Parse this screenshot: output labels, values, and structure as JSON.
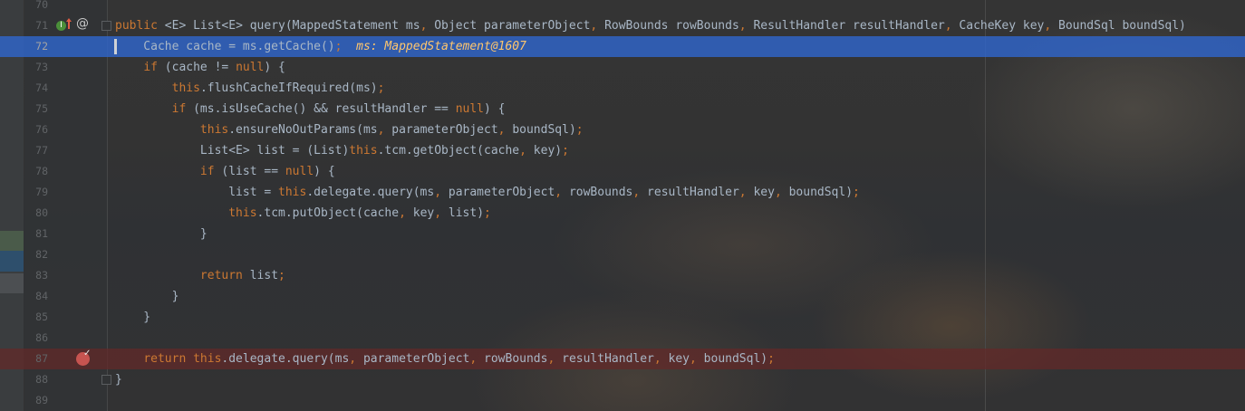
{
  "editor": {
    "lines": [
      {
        "num": "70",
        "tokens": []
      },
      {
        "num": "71",
        "tokens": [
          {
            "t": "public ",
            "c": "kw"
          },
          {
            "t": "<E> List<E> query(MappedStatement ms",
            "c": "ty"
          },
          {
            "t": ", ",
            "c": "punc"
          },
          {
            "t": "Object parameterObject",
            "c": "ty"
          },
          {
            "t": ", ",
            "c": "punc"
          },
          {
            "t": "RowBounds rowBounds",
            "c": "ty"
          },
          {
            "t": ", ",
            "c": "punc"
          },
          {
            "t": "ResultHandler resultHandler",
            "c": "ty"
          },
          {
            "t": ", ",
            "c": "punc"
          },
          {
            "t": "CacheKey key",
            "c": "ty"
          },
          {
            "t": ", ",
            "c": "punc"
          },
          {
            "t": "BoundSql boundSql)",
            "c": "ty"
          }
        ]
      },
      {
        "num": "72",
        "tokens": [
          {
            "t": "    Cache cache = ms.getCache()",
            "c": "ty"
          },
          {
            "t": ";  ",
            "c": "punc"
          },
          {
            "t": "ms: MappedStatement@1607",
            "c": "dbg"
          }
        ]
      },
      {
        "num": "73",
        "tokens": [
          {
            "t": "    ",
            "c": "ty"
          },
          {
            "t": "if ",
            "c": "kw"
          },
          {
            "t": "(cache != ",
            "c": "ty"
          },
          {
            "t": "null",
            "c": "kw"
          },
          {
            "t": ") {",
            "c": "ty"
          }
        ]
      },
      {
        "num": "74",
        "tokens": [
          {
            "t": "        ",
            "c": "ty"
          },
          {
            "t": "this",
            "c": "kw"
          },
          {
            "t": ".flushCacheIfRequired(ms)",
            "c": "ty"
          },
          {
            "t": ";",
            "c": "punc"
          }
        ]
      },
      {
        "num": "75",
        "tokens": [
          {
            "t": "        ",
            "c": "ty"
          },
          {
            "t": "if ",
            "c": "kw"
          },
          {
            "t": "(ms.isUseCache() && resultHandler == ",
            "c": "ty"
          },
          {
            "t": "null",
            "c": "kw"
          },
          {
            "t": ") {",
            "c": "ty"
          }
        ]
      },
      {
        "num": "76",
        "tokens": [
          {
            "t": "            ",
            "c": "ty"
          },
          {
            "t": "this",
            "c": "kw"
          },
          {
            "t": ".ensureNoOutParams(ms",
            "c": "ty"
          },
          {
            "t": ", ",
            "c": "punc"
          },
          {
            "t": "parameterObject",
            "c": "ty"
          },
          {
            "t": ", ",
            "c": "punc"
          },
          {
            "t": "boundSql)",
            "c": "ty"
          },
          {
            "t": ";",
            "c": "punc"
          }
        ]
      },
      {
        "num": "77",
        "tokens": [
          {
            "t": "            List<E> list = (List)",
            "c": "ty"
          },
          {
            "t": "this",
            "c": "kw"
          },
          {
            "t": ".tcm.getObject(cache",
            "c": "ty"
          },
          {
            "t": ", ",
            "c": "punc"
          },
          {
            "t": "key)",
            "c": "ty"
          },
          {
            "t": ";",
            "c": "punc"
          }
        ]
      },
      {
        "num": "78",
        "tokens": [
          {
            "t": "            ",
            "c": "ty"
          },
          {
            "t": "if ",
            "c": "kw"
          },
          {
            "t": "(list == ",
            "c": "ty"
          },
          {
            "t": "null",
            "c": "kw"
          },
          {
            "t": ") {",
            "c": "ty"
          }
        ]
      },
      {
        "num": "79",
        "tokens": [
          {
            "t": "                list = ",
            "c": "ty"
          },
          {
            "t": "this",
            "c": "kw"
          },
          {
            "t": ".delegate.query(ms",
            "c": "ty"
          },
          {
            "t": ", ",
            "c": "punc"
          },
          {
            "t": "parameterObject",
            "c": "ty"
          },
          {
            "t": ", ",
            "c": "punc"
          },
          {
            "t": "rowBounds",
            "c": "ty"
          },
          {
            "t": ", ",
            "c": "punc"
          },
          {
            "t": "resultHandler",
            "c": "ty"
          },
          {
            "t": ", ",
            "c": "punc"
          },
          {
            "t": "key",
            "c": "ty"
          },
          {
            "t": ", ",
            "c": "punc"
          },
          {
            "t": "boundSql)",
            "c": "ty"
          },
          {
            "t": ";",
            "c": "punc"
          }
        ]
      },
      {
        "num": "80",
        "tokens": [
          {
            "t": "                ",
            "c": "ty"
          },
          {
            "t": "this",
            "c": "kw"
          },
          {
            "t": ".tcm.putObject(cache",
            "c": "ty"
          },
          {
            "t": ", ",
            "c": "punc"
          },
          {
            "t": "key",
            "c": "ty"
          },
          {
            "t": ", ",
            "c": "punc"
          },
          {
            "t": "list)",
            "c": "ty"
          },
          {
            "t": ";",
            "c": "punc"
          }
        ]
      },
      {
        "num": "81",
        "tokens": [
          {
            "t": "            }",
            "c": "ty"
          }
        ]
      },
      {
        "num": "82",
        "tokens": []
      },
      {
        "num": "83",
        "tokens": [
          {
            "t": "            ",
            "c": "ty"
          },
          {
            "t": "return ",
            "c": "kw"
          },
          {
            "t": "list",
            "c": "ty"
          },
          {
            "t": ";",
            "c": "punc"
          }
        ]
      },
      {
        "num": "84",
        "tokens": [
          {
            "t": "        }",
            "c": "ty"
          }
        ]
      },
      {
        "num": "85",
        "tokens": [
          {
            "t": "    }",
            "c": "ty"
          }
        ]
      },
      {
        "num": "86",
        "tokens": []
      },
      {
        "num": "87",
        "tokens": [
          {
            "t": "    ",
            "c": "ty"
          },
          {
            "t": "return this",
            "c": "kw"
          },
          {
            "t": ".delegate.query(ms",
            "c": "ty"
          },
          {
            "t": ", ",
            "c": "punc"
          },
          {
            "t": "parameterObject",
            "c": "ty"
          },
          {
            "t": ", ",
            "c": "punc"
          },
          {
            "t": "rowBounds",
            "c": "ty"
          },
          {
            "t": ", ",
            "c": "punc"
          },
          {
            "t": "resultHandler",
            "c": "ty"
          },
          {
            "t": ", ",
            "c": "punc"
          },
          {
            "t": "key",
            "c": "ty"
          },
          {
            "t": ", ",
            "c": "punc"
          },
          {
            "t": "boundSql)",
            "c": "ty"
          },
          {
            "t": ";",
            "c": "punc"
          }
        ]
      },
      {
        "num": "88",
        "tokens": [
          {
            "t": "}",
            "c": "ty"
          }
        ]
      },
      {
        "num": "89",
        "tokens": []
      }
    ],
    "current_line": "72",
    "breakpoint_line": "87",
    "gutter_icons": {
      "implements": "implements-icon",
      "override_up": "override-up-icon",
      "annotation": "@",
      "breakpoint": "breakpoint-icon"
    },
    "colors": {
      "keyword": "#cc7832",
      "text": "#a9b7c6",
      "debug_value": "#ffc66d",
      "current_line": "#2f65ca",
      "breakpoint_line": "#642828",
      "breakpoint_dot": "#c75450"
    }
  }
}
